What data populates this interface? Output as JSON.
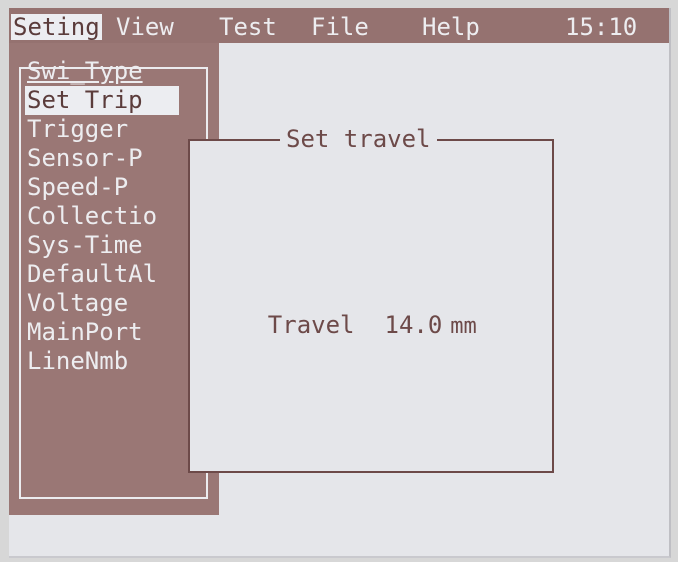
{
  "menubar": {
    "items": [
      {
        "label": "Seting",
        "active": true
      },
      {
        "label": "View",
        "active": false
      },
      {
        "label": "Test",
        "active": false
      },
      {
        "label": "File",
        "active": false
      },
      {
        "label": "Help",
        "active": false
      }
    ],
    "clock": "15:10"
  },
  "dropdown": {
    "items": [
      {
        "label": "Swi_Type"
      },
      {
        "label": "Set Trip"
      },
      {
        "label": "Trigger"
      },
      {
        "label": "Sensor-P"
      },
      {
        "label": "Speed-P"
      },
      {
        "label": "Collectio"
      },
      {
        "label": "Sys-Time"
      },
      {
        "label": "DefaultAl"
      },
      {
        "label": "Voltage"
      },
      {
        "label": "MainPort"
      },
      {
        "label": "LineNmb"
      }
    ],
    "selected_index": 1
  },
  "dialog": {
    "title": "Set travel",
    "field_label": "Travel",
    "field_value": "14.0",
    "field_unit": "mm"
  },
  "colors": {
    "menu_bg": "#957270",
    "dropdown_bg": "#9a7775",
    "screen_bg": "#e5e6ea",
    "lcd_text": "#6d4a49",
    "highlight": "#ecedf1"
  }
}
